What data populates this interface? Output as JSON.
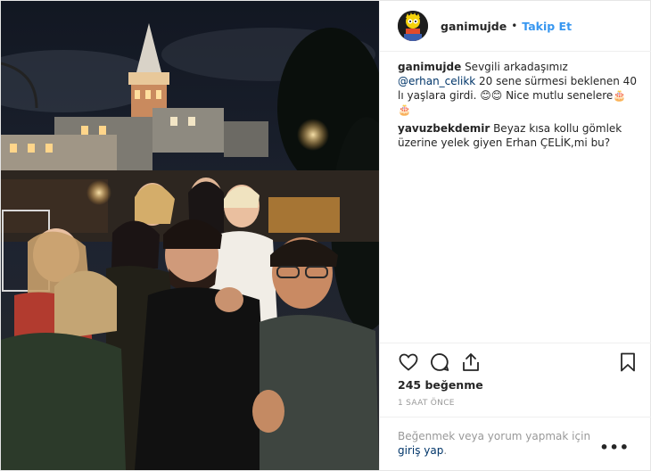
{
  "header": {
    "username": "ganimujde",
    "separator": "•",
    "follow_label": "Takip Et"
  },
  "caption": {
    "username": "ganimujde",
    "text_before": "Sevgili arkadaşımız ",
    "mention": "@erhan_celikk",
    "text_after": " 20 sene sürmesi beklenen 40 lı yaşlara girdi. 😊😊 Nice mutlu senelere🎂🎂"
  },
  "comments": [
    {
      "username": "yavuzbekdemir",
      "text": "Beyaz kısa kollu gömlek üzerine yelek giyen Erhan ÇELİK,mi bu?"
    }
  ],
  "actions": {
    "like_icon": "heart-icon",
    "comment_icon": "comment-icon",
    "share_icon": "share-icon",
    "save_icon": "bookmark-icon"
  },
  "likes_label": "245 beğenme",
  "timestamp": "1 SAAT ÖNCE",
  "login_prompt": {
    "text": "Beğenmek veya yorum yapmak için ",
    "link": "giriş yap",
    "suffix": "."
  },
  "more_label": "•••",
  "colors": {
    "accent": "#3897f0",
    "mention": "#003569",
    "muted": "#999999",
    "text": "#262626"
  }
}
